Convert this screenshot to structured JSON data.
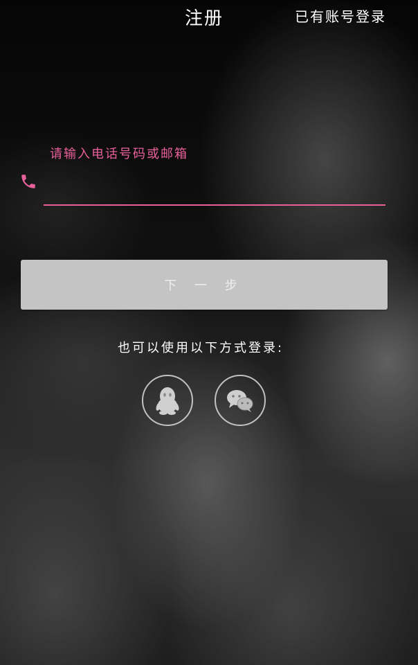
{
  "header": {
    "title": "注册",
    "login_link": "已有账号登录"
  },
  "form": {
    "phone_hint": "请输入电话号码或邮箱",
    "phone_value": "",
    "next_button": "下 一 步"
  },
  "social": {
    "prompt": "也可以使用以下方式登录:",
    "icons": [
      "qq-icon",
      "wechat-icon"
    ]
  },
  "colors": {
    "accent": "#e8609a",
    "button_bg": "#c4c4c4",
    "text": "#ffffff"
  }
}
